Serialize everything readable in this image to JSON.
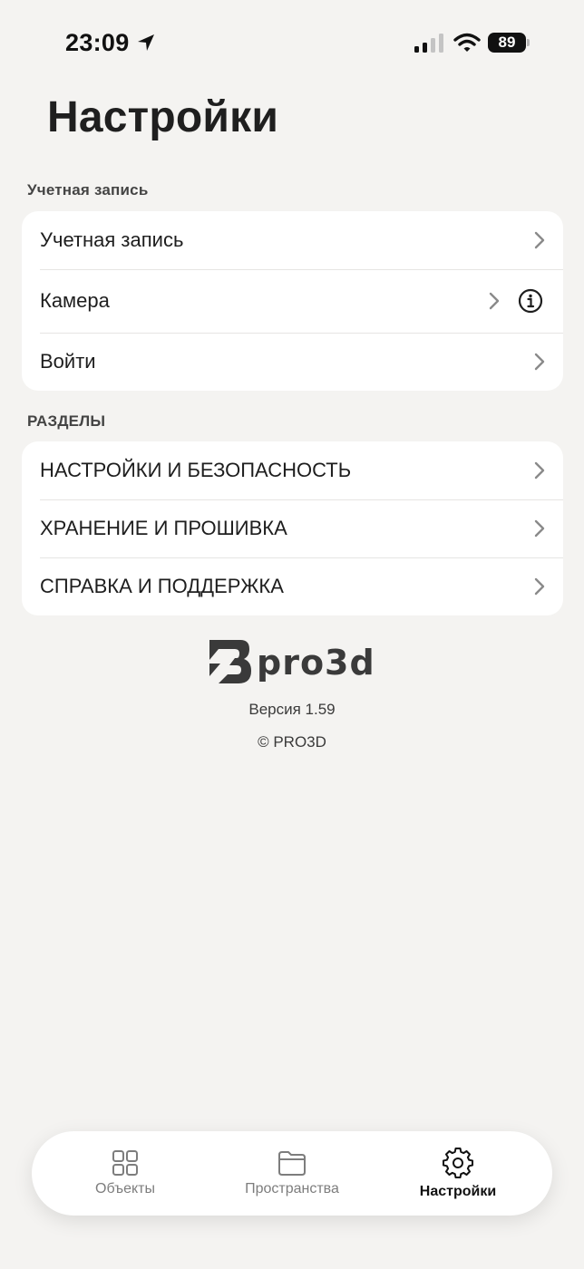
{
  "status_bar": {
    "time": "23:09",
    "battery": "89",
    "icons": [
      "location-arrow-icon",
      "cellular-signal-icon",
      "wifi-icon",
      "battery-icon"
    ]
  },
  "page_title": "Настройки",
  "account_section": {
    "header": "Учетная запись",
    "items": [
      {
        "label": "Учетная запись",
        "icon": "chevron-right-icon"
      },
      {
        "label": "Камера",
        "icon": "chevron-right-icon",
        "extra_icon": "info-icon"
      },
      {
        "label": "Войти",
        "icon": "chevron-right-icon"
      }
    ]
  },
  "sections_section": {
    "header": "РАЗДЕЛЫ",
    "items": [
      {
        "label": "НАСТРОЙКИ И БЕЗОПАСНОСТЬ",
        "icon": "chevron-right-icon"
      },
      {
        "label": "ХРАНЕНИЕ И ПРОШИВКА",
        "icon": "chevron-right-icon"
      },
      {
        "label": "СПРАВКА И ПОДДЕРЖКА",
        "icon": "chevron-right-icon"
      }
    ]
  },
  "logo": {
    "text": "pro3d",
    "icon": "pro3d-logo-icon"
  },
  "footer": {
    "version": "Версия 1.59",
    "copyright": "© PRO3D"
  },
  "tab_bar": {
    "tabs": [
      {
        "label": "Объекты",
        "icon": "grid-icon",
        "active": false
      },
      {
        "label": "Пространства",
        "icon": "folder-icon",
        "active": false
      },
      {
        "label": "Настройки",
        "icon": "gear-icon",
        "active": true
      }
    ]
  },
  "colors": {
    "background": "#f4f3f1",
    "card": "#ffffff",
    "text": "#1c1c1c",
    "secondary_text": "#7d7d7d",
    "chevron": "#8a8a8a"
  }
}
